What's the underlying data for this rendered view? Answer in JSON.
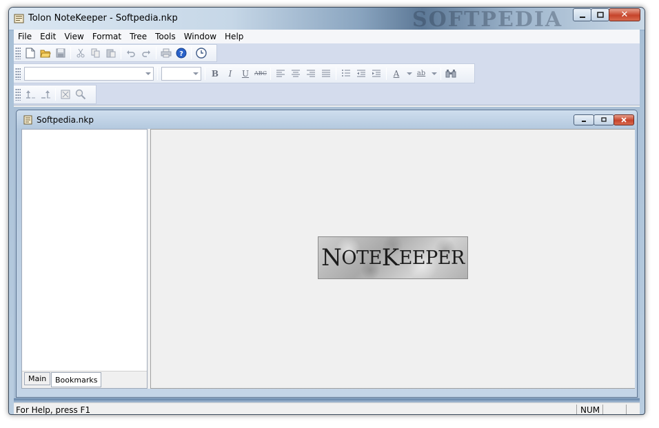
{
  "window": {
    "title": "Tolon NoteKeeper - Softpedia.nkp",
    "watermark": "SOFTPEDIA",
    "minimize_label": "–",
    "maximize_label": "□",
    "close_label": "✕"
  },
  "menu": {
    "items": [
      "File",
      "Edit",
      "View",
      "Format",
      "Tree",
      "Tools",
      "Window",
      "Help"
    ]
  },
  "toolbar_main": {
    "buttons": [
      "new-icon",
      "open-icon",
      "save-icon",
      "cut-icon",
      "copy-icon",
      "paste-icon",
      "undo-icon",
      "redo-icon",
      "print-icon",
      "help-icon",
      "clock-icon"
    ]
  },
  "toolbar_format": {
    "font_value": "",
    "size_value": "",
    "bold": "B",
    "italic": "I",
    "underline": "U",
    "strikethrough": "ABC",
    "font_color_glyph": "A",
    "highlight_glyph": "ab",
    "find_glyph": "ὐd"
  },
  "toolbar_tree": {
    "buttons": [
      "move-up-icon",
      "move-down-icon",
      "zoom-fit-icon",
      "search-icon"
    ]
  },
  "document": {
    "title": "Softpedia.nkp",
    "tabs": [
      "Main",
      "Bookmarks"
    ],
    "active_tab": "Bookmarks",
    "logo_text_first": "N",
    "logo_text_first_rest": "OTE",
    "logo_text_second": "K",
    "logo_text_second_rest": "EEPER"
  },
  "status": {
    "help_text": "For Help, press F1",
    "num_indicator": "NUM"
  }
}
